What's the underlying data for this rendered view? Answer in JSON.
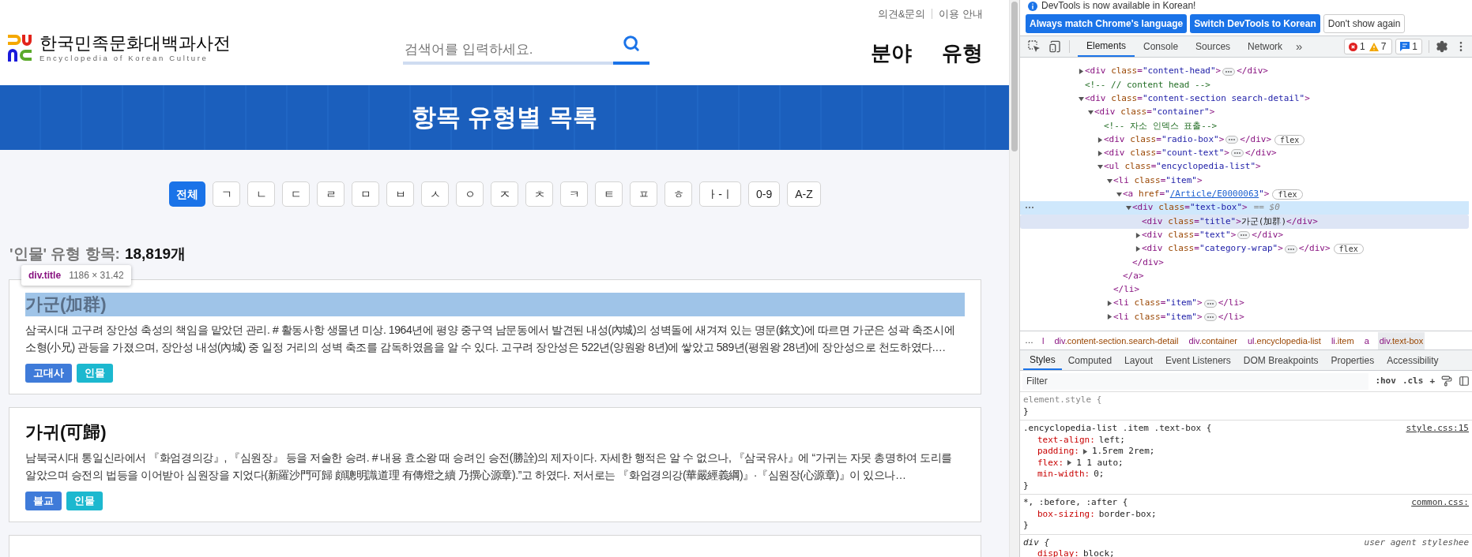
{
  "page": {
    "top_links": [
      "의견&문의",
      "이용 안내"
    ],
    "logo": {
      "title": "한국민족문화대백과사전",
      "subtitle": "Encyclopedia of Korean Culture"
    },
    "search": {
      "placeholder": "검색어를 입력하세요."
    },
    "nav": [
      "분야",
      "유형"
    ],
    "banner": {
      "title": "항목 유형별 목록"
    },
    "index_buttons": [
      {
        "label": "전체",
        "selected": true
      },
      {
        "label": "ㄱ",
        "selected": false
      },
      {
        "label": "ㄴ",
        "selected": false
      },
      {
        "label": "ㄷ",
        "selected": false
      },
      {
        "label": "ㄹ",
        "selected": false
      },
      {
        "label": "ㅁ",
        "selected": false
      },
      {
        "label": "ㅂ",
        "selected": false
      },
      {
        "label": "ㅅ",
        "selected": false
      },
      {
        "label": "ㅇ",
        "selected": false
      },
      {
        "label": "ㅈ",
        "selected": false
      },
      {
        "label": "ㅊ",
        "selected": false
      },
      {
        "label": "ㅋ",
        "selected": false
      },
      {
        "label": "ㅌ",
        "selected": false
      },
      {
        "label": "ㅍ",
        "selected": false
      },
      {
        "label": "ㅎ",
        "selected": false
      },
      {
        "label": "ㅏ-ㅣ",
        "selected": false
      },
      {
        "label": "0-9",
        "selected": false
      },
      {
        "label": "A-Z",
        "selected": false
      }
    ],
    "count": {
      "label": "'인물' 유형 항목:",
      "value": "18,819개"
    },
    "inspector_tooltip": {
      "element": "div.title",
      "size": "1186 × 31.42"
    },
    "entries": [
      {
        "title": "가군(加群)",
        "highlighted": true,
        "summary": "삼국시대 고구려 장안성 축성의 책임을 맡았던 관리. # 활동사항 생몰년 미상. 1964년에 평양 중구역 남문동에서 발견된 내성(內城)의 성벽돌에 새겨져 있는 명문(銘文)에 따르면 가군은 성곽 축조시에 소형(小兄) 관등을 가졌으며, 장안성 내성(內城) 중 일정 거리의 성벽 축조를 감독하였음을 알 수 있다. 고구려 장안성은 522년(양원왕 8년)에 쌓았고 589년(평원왕 28년)에 장안성으로 천도하였다.…",
        "tags": [
          {
            "label": "고대사",
            "color": "#3f7bd9"
          },
          {
            "label": "인물",
            "color": "#1cb8cf"
          }
        ]
      },
      {
        "title": "가귀(可歸)",
        "highlighted": false,
        "summary": "남북국시대 통일신라에서 『화엄경의강』, 『심원장』 등을 저술한 승려. # 내용 효소왕 때 승려인 승전(勝詮)의 제자이다. 자세한 행적은 알 수 없으나, 『삼국유사』에 “가귀는 자못 총명하여 도리를 알았으며 승전의 법등을 이어받아 심원장을 지었다(新羅沙門可歸 頗聰明識道理 有傳燈之續 乃撰心源章).”고 하였다. 저서로는 『화엄경의강(華嚴經義綱)』·『심원장(心源章)』이 있으나…",
        "tags": [
          {
            "label": "불교",
            "color": "#3f7bd9"
          },
          {
            "label": "인물",
            "color": "#1cb8cf"
          }
        ]
      }
    ]
  },
  "devtools": {
    "notice": {
      "text": "DevTools is now available in Korean!",
      "buttons": [
        {
          "label": "Always match Chrome's language",
          "kind": "primary"
        },
        {
          "label": "Switch DevTools to Korean",
          "kind": "primary"
        },
        {
          "label": "Don't show again",
          "kind": "secondary"
        }
      ]
    },
    "tabs": [
      {
        "label": "Elements",
        "selected": true
      },
      {
        "label": "Console",
        "selected": false
      },
      {
        "label": "Sources",
        "selected": false
      },
      {
        "label": "Network",
        "selected": false
      }
    ],
    "more_tabs": "»",
    "issues": [
      {
        "kind": "error",
        "count": "1"
      },
      {
        "kind": "warning",
        "count": "7"
      }
    ],
    "messages": {
      "count": "1"
    },
    "dom_tree": [
      {
        "kind": "element",
        "text": "<div class=\"content-head\">",
        "close": "</div>",
        "expanded": false,
        "selected": false,
        "hovered": false
      },
      {
        "kind": "comment",
        "text": "<!-- // content head -->",
        "selected": false,
        "hovered": false
      },
      {
        "kind": "element",
        "text": "<div class=\"content-section search-detail\">",
        "expanded": true,
        "selected": false,
        "hovered": false,
        "children": [
          {
            "kind": "element",
            "text": "<div class=\"container\">",
            "expanded": true,
            "selected": false,
            "hovered": false,
            "children": [
              {
                "kind": "comment",
                "text": "<!-- 자소 인덱스 표출-->",
                "selected": false,
                "hovered": false
              },
              {
                "kind": "element",
                "text": "<div class=\"radio-box\">",
                "close": "</div>",
                "expanded": false,
                "badge": "flex",
                "selected": false,
                "hovered": false
              },
              {
                "kind": "element",
                "text": "<div class=\"count-text\">",
                "close": "</div>",
                "expanded": false,
                "selected": false,
                "hovered": false
              },
              {
                "kind": "element",
                "text": "<ul class=\"encyclopedia-list\">",
                "expanded": true,
                "selected": false,
                "hovered": false,
                "children": [
                  {
                    "kind": "element",
                    "text": "<li class=\"item\">",
                    "close": "</li>",
                    "expanded": true,
                    "selected": false,
                    "hovered": false,
                    "children": [
                      {
                        "kind": "element",
                        "text": "<a href=\"/Article/E0000063\">",
                        "close": "</a>",
                        "expanded": true,
                        "badge": "flex",
                        "link": true,
                        "selected": false,
                        "hovered": false,
                        "children": [
                          {
                            "kind": "element",
                            "text": "<div class=\"text-box\">",
                            "close": "</div>",
                            "expanded": true,
                            "suffix": "== $0",
                            "selected": true,
                            "hovered": false,
                            "children": [
                              {
                                "kind": "leaf",
                                "text": "<div class=\"title\">가군(加群)</div>",
                                "selected": false,
                                "hovered": true
                              },
                              {
                                "kind": "element",
                                "text": "<div class=\"text\">",
                                "close": "</div>",
                                "expanded": false,
                                "selected": false,
                                "hovered": false
                              },
                              {
                                "kind": "element",
                                "text": "<div class=\"category-wrap\">",
                                "close": "</div>",
                                "expanded": false,
                                "badge": "flex",
                                "selected": false,
                                "hovered": false
                              }
                            ]
                          }
                        ]
                      }
                    ]
                  },
                  {
                    "kind": "element",
                    "text": "<li class=\"item\">",
                    "close": "</li>",
                    "expanded": false,
                    "selected": false,
                    "hovered": false
                  },
                  {
                    "kind": "element",
                    "text": "<li class=\"item\">",
                    "close": "</li>",
                    "expanded": false,
                    "selected": false,
                    "hovered": false
                  }
                ]
              }
            ]
          }
        ]
      }
    ],
    "breadcrumbs": {
      "overflow": "…",
      "items": [
        {
          "text": "l",
          "selected": false
        },
        {
          "text": "div.content-section.search-detail",
          "selected": false
        },
        {
          "text": "div.container",
          "selected": false
        },
        {
          "text": "ul.encyclopedia-list",
          "selected": false
        },
        {
          "text": "li.item",
          "selected": false
        },
        {
          "text": "a",
          "selected": false
        },
        {
          "text": "div.text-box",
          "selected": true
        }
      ]
    },
    "style_tabs": [
      {
        "label": "Styles",
        "selected": true
      },
      {
        "label": "Computed",
        "selected": false
      },
      {
        "label": "Layout",
        "selected": false
      },
      {
        "label": "Event Listeners",
        "selected": false
      },
      {
        "label": "DOM Breakpoints",
        "selected": false
      },
      {
        "label": "Properties",
        "selected": false
      },
      {
        "label": "Accessibility",
        "selected": false
      }
    ],
    "filter": {
      "placeholder": "Filter",
      "buttons": [
        ":hov",
        ".cls",
        "+"
      ]
    },
    "rules": [
      {
        "kind": "inline",
        "selector": "element.style {",
        "close": "}"
      },
      {
        "kind": "author",
        "selector": ".encyclopedia-list .item .text-box {",
        "source": "style.css:15",
        "close": "}",
        "properties": [
          {
            "name": "text-align:",
            "value": "left;",
            "expandable": false
          },
          {
            "name": "padding:",
            "value": "1.5rem 2rem;",
            "expandable": true
          },
          {
            "name": "flex:",
            "value": "1 1 auto;",
            "expandable": true
          },
          {
            "name": "min-width:",
            "value": "0;",
            "expandable": false
          }
        ]
      },
      {
        "kind": "author",
        "selector": "*, :before, :after {",
        "source": "common.css:",
        "close": "}",
        "properties": [
          {
            "name": "box-sizing:",
            "value": "border-box;",
            "expandable": false
          }
        ]
      },
      {
        "kind": "user-agent",
        "selector": "div {",
        "source": "user agent styleshee",
        "properties": [
          {
            "name": "display:",
            "value": "block;",
            "expandable": false
          }
        ]
      }
    ]
  }
}
